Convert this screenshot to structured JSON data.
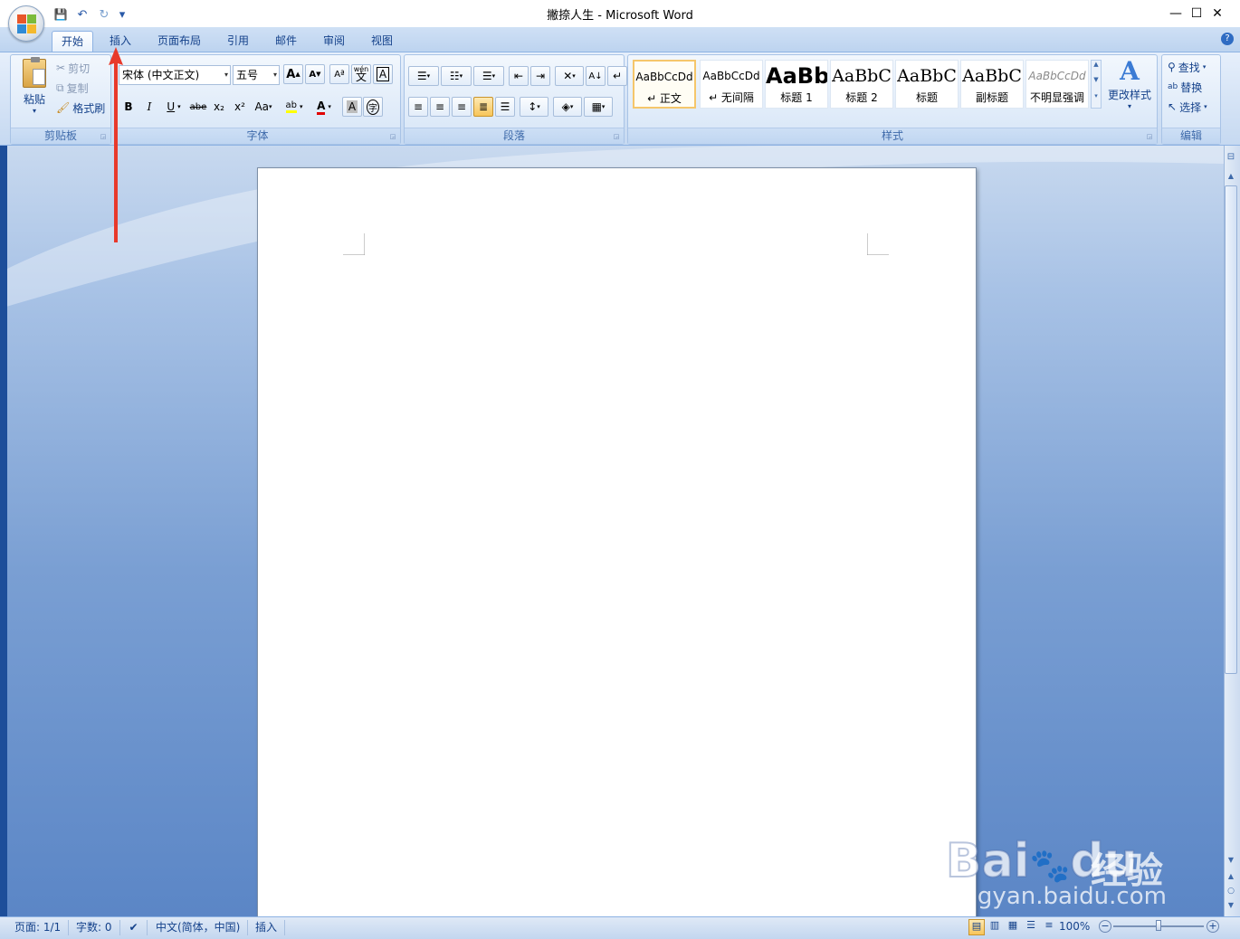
{
  "window": {
    "title": "撇捺人生 - Microsoft Word",
    "minimize": "—",
    "maximize": "☐",
    "close": "✕"
  },
  "qat": {
    "save": "💾",
    "undo": "↶",
    "redo": "↻",
    "customize": "▾"
  },
  "tabs": [
    "开始",
    "插入",
    "页面布局",
    "引用",
    "邮件",
    "审阅",
    "视图"
  ],
  "help": "?",
  "clipboard": {
    "label": "剪贴板",
    "paste": "粘贴",
    "cut": "剪切",
    "copy": "复制",
    "format_painter": "格式刷"
  },
  "font": {
    "label": "字体",
    "name": "宋体 (中文正文)",
    "size": "五号",
    "grow": "A",
    "shrink": "A",
    "bold": "B",
    "italic": "I",
    "underline": "U",
    "strike": "abe",
    "sub": "x₂",
    "sup": "x²",
    "case": "Aa",
    "phonetic": "wén",
    "phonetic_char": "文",
    "border_char": "A",
    "shade_char": "A",
    "enclose": "字",
    "font_color": "A"
  },
  "paragraph": {
    "label": "段落"
  },
  "styles": {
    "label": "样式",
    "items": [
      {
        "preview": "AaBbCcDd",
        "name": "↵ 正文"
      },
      {
        "preview": "AaBbCcDd",
        "name": "↵ 无间隔"
      },
      {
        "preview": "AaBb",
        "name": "标题 1"
      },
      {
        "preview": "AaBbC",
        "name": "标题 2"
      },
      {
        "preview": "AaBbC",
        "name": "标题"
      },
      {
        "preview": "AaBbC",
        "name": "副标题"
      },
      {
        "preview": "AaBbCcDd",
        "name": "不明显强调"
      }
    ],
    "change": "更改样式"
  },
  "editing": {
    "label": "编辑",
    "find": "查找",
    "replace": "替换",
    "select": "选择"
  },
  "status": {
    "page": "页面: 1/1",
    "words": "字数: 0",
    "lang": "中文(简体，中国)",
    "mode": "插入",
    "zoom": "100%"
  },
  "watermark": {
    "brand": "Bai",
    "brand2": "du",
    "brand_cn": "经验",
    "url": "jingyan.baidu.com"
  },
  "colors": {
    "accent": "#15428b",
    "ribbon_bg": "#c6d9f1",
    "workspace": "#6f96cf",
    "arrow": "#e8392b"
  }
}
